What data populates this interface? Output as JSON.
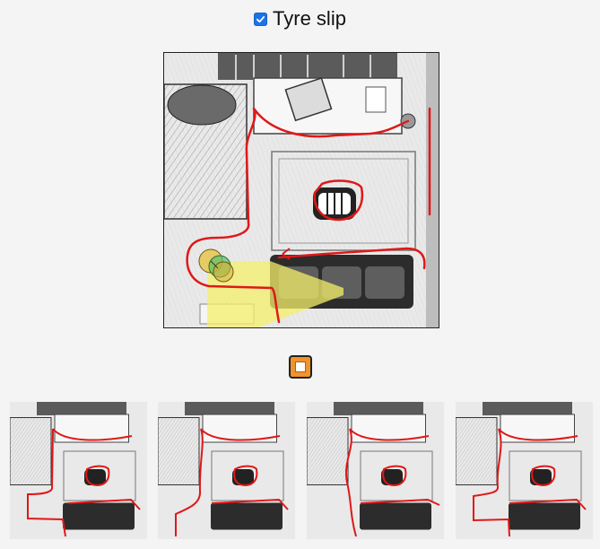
{
  "toolbar": {
    "checkbox_label": "Tyre slip",
    "checkbox_checked": true
  },
  "controls": {
    "stop_icon": "stop-square-icon",
    "accent_color": "#f0932a"
  },
  "scene": {
    "path_color": "#e01818",
    "highlight_color": "#f4ef6a",
    "robot_colors": [
      "#e6c23a",
      "#5bbf6a",
      "#d9b23a"
    ]
  },
  "thumbnails": [
    {
      "name": "thumbnail-1"
    },
    {
      "name": "thumbnail-2"
    },
    {
      "name": "thumbnail-3"
    },
    {
      "name": "thumbnail-4"
    }
  ]
}
